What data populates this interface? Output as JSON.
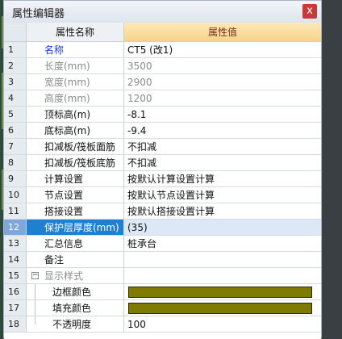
{
  "window": {
    "title": "属性编辑器",
    "close_label": "x"
  },
  "header": {
    "name_col": "属性名称",
    "value_col": "属性值"
  },
  "rows": [
    {
      "num": "1",
      "name": "名称",
      "value": "CT5 (改1)"
    },
    {
      "num": "2",
      "name": "长度(mm)",
      "value": "3500"
    },
    {
      "num": "3",
      "name": "宽度(mm)",
      "value": "2900"
    },
    {
      "num": "4",
      "name": "高度(mm)",
      "value": "1200"
    },
    {
      "num": "5",
      "name": "顶标高(m)",
      "value": "-8.1"
    },
    {
      "num": "6",
      "name": "底标高(m)",
      "value": "-9.4"
    },
    {
      "num": "7",
      "name": "扣减板/筏板面筋",
      "value": "不扣减"
    },
    {
      "num": "8",
      "name": "扣减板/筏板底筋",
      "value": "不扣减"
    },
    {
      "num": "9",
      "name": "计算设置",
      "value": "按默认计算设置计算"
    },
    {
      "num": "10",
      "name": "节点设置",
      "value": "按默认节点设置计算"
    },
    {
      "num": "11",
      "name": "搭接设置",
      "value": "按默认搭接设置计算"
    },
    {
      "num": "12",
      "name": "保护层厚度(mm)",
      "value": "(35)"
    },
    {
      "num": "13",
      "name": "汇总信息",
      "value": "桩承台"
    },
    {
      "num": "14",
      "name": "备注",
      "value": ""
    },
    {
      "num": "15",
      "name": "显示样式",
      "value": ""
    },
    {
      "num": "16",
      "name": "边框颜色",
      "value": ""
    },
    {
      "num": "17",
      "name": "填充颜色",
      "value": ""
    },
    {
      "num": "18",
      "name": "不透明度",
      "value": "100"
    }
  ],
  "tree_toggle": "−",
  "colors": {
    "swatch": "#7f7a00",
    "selected_row": "#1f7fd1",
    "header_value_bg": "#f6d38a"
  },
  "icons": {
    "close": "close-icon",
    "collapse": "collapse-icon"
  }
}
